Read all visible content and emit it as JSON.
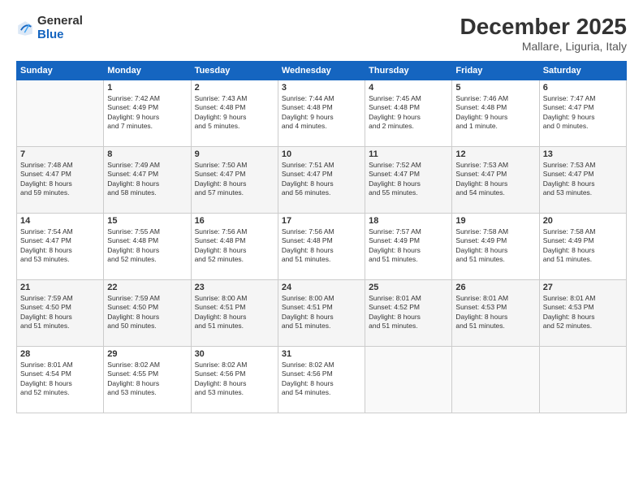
{
  "logo": {
    "general": "General",
    "blue": "Blue"
  },
  "title": "December 2025",
  "location": "Mallare, Liguria, Italy",
  "days_header": [
    "Sunday",
    "Monday",
    "Tuesday",
    "Wednesday",
    "Thursday",
    "Friday",
    "Saturday"
  ],
  "weeks": [
    [
      {
        "day": "",
        "info": ""
      },
      {
        "day": "1",
        "info": "Sunrise: 7:42 AM\nSunset: 4:49 PM\nDaylight: 9 hours\nand 7 minutes."
      },
      {
        "day": "2",
        "info": "Sunrise: 7:43 AM\nSunset: 4:48 PM\nDaylight: 9 hours\nand 5 minutes."
      },
      {
        "day": "3",
        "info": "Sunrise: 7:44 AM\nSunset: 4:48 PM\nDaylight: 9 hours\nand 4 minutes."
      },
      {
        "day": "4",
        "info": "Sunrise: 7:45 AM\nSunset: 4:48 PM\nDaylight: 9 hours\nand 2 minutes."
      },
      {
        "day": "5",
        "info": "Sunrise: 7:46 AM\nSunset: 4:48 PM\nDaylight: 9 hours\nand 1 minute."
      },
      {
        "day": "6",
        "info": "Sunrise: 7:47 AM\nSunset: 4:47 PM\nDaylight: 9 hours\nand 0 minutes."
      }
    ],
    [
      {
        "day": "7",
        "info": "Sunrise: 7:48 AM\nSunset: 4:47 PM\nDaylight: 8 hours\nand 59 minutes."
      },
      {
        "day": "8",
        "info": "Sunrise: 7:49 AM\nSunset: 4:47 PM\nDaylight: 8 hours\nand 58 minutes."
      },
      {
        "day": "9",
        "info": "Sunrise: 7:50 AM\nSunset: 4:47 PM\nDaylight: 8 hours\nand 57 minutes."
      },
      {
        "day": "10",
        "info": "Sunrise: 7:51 AM\nSunset: 4:47 PM\nDaylight: 8 hours\nand 56 minutes."
      },
      {
        "day": "11",
        "info": "Sunrise: 7:52 AM\nSunset: 4:47 PM\nDaylight: 8 hours\nand 55 minutes."
      },
      {
        "day": "12",
        "info": "Sunrise: 7:53 AM\nSunset: 4:47 PM\nDaylight: 8 hours\nand 54 minutes."
      },
      {
        "day": "13",
        "info": "Sunrise: 7:53 AM\nSunset: 4:47 PM\nDaylight: 8 hours\nand 53 minutes."
      }
    ],
    [
      {
        "day": "14",
        "info": "Sunrise: 7:54 AM\nSunset: 4:47 PM\nDaylight: 8 hours\nand 53 minutes."
      },
      {
        "day": "15",
        "info": "Sunrise: 7:55 AM\nSunset: 4:48 PM\nDaylight: 8 hours\nand 52 minutes."
      },
      {
        "day": "16",
        "info": "Sunrise: 7:56 AM\nSunset: 4:48 PM\nDaylight: 8 hours\nand 52 minutes."
      },
      {
        "day": "17",
        "info": "Sunrise: 7:56 AM\nSunset: 4:48 PM\nDaylight: 8 hours\nand 51 minutes."
      },
      {
        "day": "18",
        "info": "Sunrise: 7:57 AM\nSunset: 4:49 PM\nDaylight: 8 hours\nand 51 minutes."
      },
      {
        "day": "19",
        "info": "Sunrise: 7:58 AM\nSunset: 4:49 PM\nDaylight: 8 hours\nand 51 minutes."
      },
      {
        "day": "20",
        "info": "Sunrise: 7:58 AM\nSunset: 4:49 PM\nDaylight: 8 hours\nand 51 minutes."
      }
    ],
    [
      {
        "day": "21",
        "info": "Sunrise: 7:59 AM\nSunset: 4:50 PM\nDaylight: 8 hours\nand 51 minutes."
      },
      {
        "day": "22",
        "info": "Sunrise: 7:59 AM\nSunset: 4:50 PM\nDaylight: 8 hours\nand 50 minutes."
      },
      {
        "day": "23",
        "info": "Sunrise: 8:00 AM\nSunset: 4:51 PM\nDaylight: 8 hours\nand 51 minutes."
      },
      {
        "day": "24",
        "info": "Sunrise: 8:00 AM\nSunset: 4:51 PM\nDaylight: 8 hours\nand 51 minutes."
      },
      {
        "day": "25",
        "info": "Sunrise: 8:01 AM\nSunset: 4:52 PM\nDaylight: 8 hours\nand 51 minutes."
      },
      {
        "day": "26",
        "info": "Sunrise: 8:01 AM\nSunset: 4:53 PM\nDaylight: 8 hours\nand 51 minutes."
      },
      {
        "day": "27",
        "info": "Sunrise: 8:01 AM\nSunset: 4:53 PM\nDaylight: 8 hours\nand 52 minutes."
      }
    ],
    [
      {
        "day": "28",
        "info": "Sunrise: 8:01 AM\nSunset: 4:54 PM\nDaylight: 8 hours\nand 52 minutes."
      },
      {
        "day": "29",
        "info": "Sunrise: 8:02 AM\nSunset: 4:55 PM\nDaylight: 8 hours\nand 53 minutes."
      },
      {
        "day": "30",
        "info": "Sunrise: 8:02 AM\nSunset: 4:56 PM\nDaylight: 8 hours\nand 53 minutes."
      },
      {
        "day": "31",
        "info": "Sunrise: 8:02 AM\nSunset: 4:56 PM\nDaylight: 8 hours\nand 54 minutes."
      },
      {
        "day": "",
        "info": ""
      },
      {
        "day": "",
        "info": ""
      },
      {
        "day": "",
        "info": ""
      }
    ]
  ]
}
